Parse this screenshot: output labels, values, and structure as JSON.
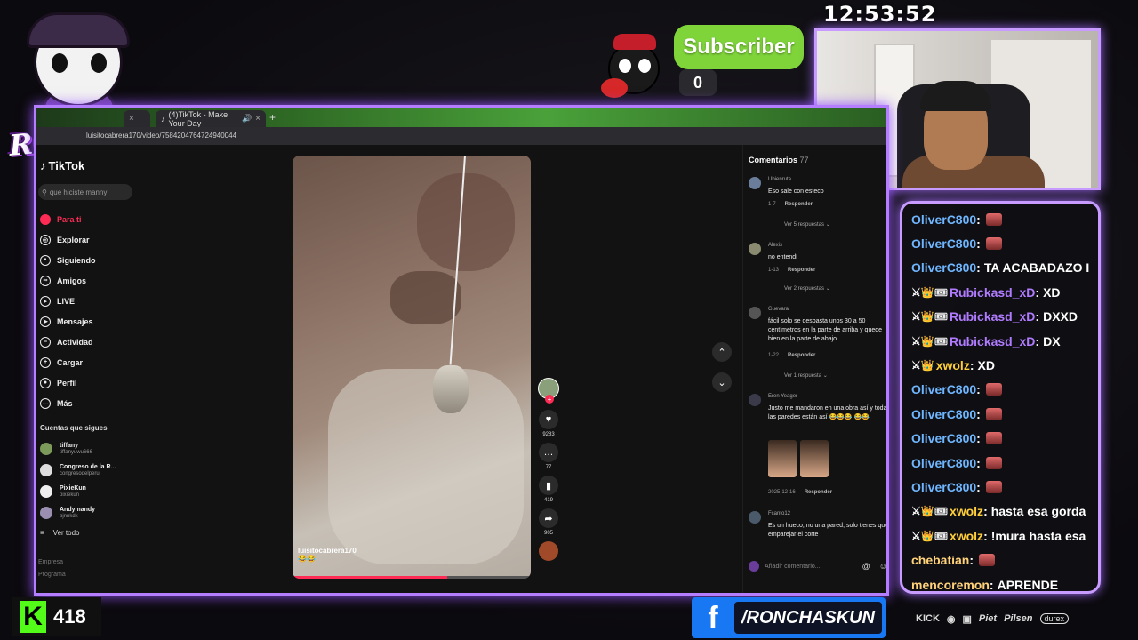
{
  "stream": {
    "logo_text": "RONCHAS",
    "clock": "12:53:52",
    "subscriber_label": "Subscriber",
    "subscriber_count": "0",
    "kick_count": "418",
    "facebook_handle": "/RONCHASKUN",
    "sponsors": [
      "KICK",
      "Piet",
      "Pilsen",
      "durex"
    ]
  },
  "browser": {
    "tabs": [
      {
        "label": "(4)TikTok - Make Your Day"
      }
    ],
    "new_tab": "+",
    "url": "luisitocabrera170/video/7584204764724940044"
  },
  "tiktok": {
    "brand": "TikTok",
    "search_placeholder": "que hiciste manny",
    "nav": [
      {
        "label": "Para ti",
        "icon": "home-icon",
        "active": true
      },
      {
        "label": "Explorar",
        "icon": "compass-icon"
      },
      {
        "label": "Siguiendo",
        "icon": "following-icon"
      },
      {
        "label": "Amigos",
        "icon": "friends-icon"
      },
      {
        "label": "LIVE",
        "icon": "live-icon"
      },
      {
        "label": "Mensajes",
        "icon": "messages-icon"
      },
      {
        "label": "Actividad",
        "icon": "activity-icon"
      },
      {
        "label": "Cargar",
        "icon": "upload-icon"
      },
      {
        "label": "Perfil",
        "icon": "profile-icon"
      },
      {
        "label": "Más",
        "icon": "more-icon"
      }
    ],
    "following_header": "Cuentas que sigues",
    "following": [
      {
        "name": "tiffany",
        "handle": "tiffanyuwu666"
      },
      {
        "name": "Congreso de la R...",
        "handle": "congresodelperu"
      },
      {
        "name": "PixieKun",
        "handle": "pixiekun"
      },
      {
        "name": "Andymandy",
        "handle": "bjnnkdk"
      }
    ],
    "see_all": "Ver todo",
    "footer": [
      "Empresa",
      "Programa"
    ],
    "video": {
      "author": "luisitocabrera170",
      "emojis": "😂😂",
      "progress": 0.65
    },
    "actions": [
      {
        "icon": "heart-icon",
        "count": "9283"
      },
      {
        "icon": "comment-icon",
        "count": "77"
      },
      {
        "icon": "bookmark-icon",
        "count": "419"
      },
      {
        "icon": "share-icon",
        "count": "905"
      }
    ],
    "comments_title": "Comentarios",
    "comments_count": "77",
    "comments": [
      {
        "user": "Ubienruta",
        "text": "Eso sale con esteco",
        "meta": "1-7",
        "reply": "Responder",
        "more": "Ver 5 respuestas"
      },
      {
        "user": "Alexis",
        "text": "no entendí",
        "meta": "1-13",
        "reply": "Responder",
        "more": "Ver 2 respuestas"
      },
      {
        "user": "Guevara",
        "text": "fácil solo se desbasta unos 30 a 50 centímetros en la parte de arriba y quede bien en la parte de abajo",
        "meta": "1-22",
        "reply": "Responder",
        "more": "Ver 1 respuesta"
      },
      {
        "user": "Eren Yeager",
        "text": "Justo me mandaron en una obra así y todas las paredes están así 😂😂😂 😂😂",
        "meta": "2025-12-16",
        "reply": "Responder",
        "more": ""
      },
      {
        "user": "Fcanto12",
        "text": "Es un hueco, no una pared, solo tienes que emparejar el corte",
        "meta": "",
        "reply": "",
        "more": ""
      }
    ],
    "add_comment_placeholder": "Añadir comentario..."
  },
  "chat": {
    "colors": {
      "oliver": "#6fb6ff",
      "rubick": "#b07cff",
      "xwolz": "#ffcf3a",
      "chebatian": "#ffd27a",
      "mencoremon": "#ffd27a",
      "message": "#ffffff"
    },
    "messages": [
      {
        "user": "OliverC800",
        "text": "",
        "emote": true,
        "badges": "",
        "color": "oliver"
      },
      {
        "user": "OliverC800",
        "text": "",
        "emote": true,
        "badges": "",
        "color": "oliver"
      },
      {
        "user": "OliverC800",
        "text": "TA ACABADAZO I",
        "emote": false,
        "badges": "",
        "color": "oliver"
      },
      {
        "user": "Rubickasd_xD",
        "text": "XD",
        "emote": false,
        "badges": "⚔👑🎟",
        "color": "rubick"
      },
      {
        "user": "Rubickasd_xD",
        "text": "DXXD",
        "emote": false,
        "badges": "⚔👑🎟",
        "color": "rubick"
      },
      {
        "user": "Rubickasd_xD",
        "text": "DX",
        "emote": false,
        "badges": "⚔👑🎟",
        "color": "rubick"
      },
      {
        "user": "xwolz",
        "text": "XD",
        "emote": false,
        "badges": "⚔👑",
        "color": "xwolz"
      },
      {
        "user": "OliverC800",
        "text": "",
        "emote": true,
        "badges": "",
        "color": "oliver"
      },
      {
        "user": "OliverC800",
        "text": "",
        "emote": true,
        "badges": "",
        "color": "oliver"
      },
      {
        "user": "OliverC800",
        "text": "",
        "emote": true,
        "badges": "",
        "color": "oliver"
      },
      {
        "user": "OliverC800",
        "text": "",
        "emote": true,
        "badges": "",
        "color": "oliver"
      },
      {
        "user": "OliverC800",
        "text": "",
        "emote": true,
        "badges": "",
        "color": "oliver"
      },
      {
        "user": "xwolz",
        "text": "hasta esa gorda",
        "emote": false,
        "badges": "⚔👑🎟",
        "color": "xwolz"
      },
      {
        "user": "xwolz",
        "text": "!mura hasta esa",
        "emote": false,
        "badges": "⚔👑🎟",
        "color": "xwolz"
      },
      {
        "user": "chebatian",
        "text": "",
        "emote": true,
        "badges": "",
        "color": "chebatian"
      },
      {
        "user": "mencoremon",
        "text": "APRENDE",
        "emote": false,
        "badges": "",
        "color": "mencoremon"
      }
    ]
  }
}
